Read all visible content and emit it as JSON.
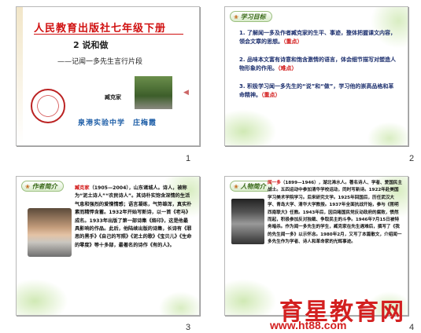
{
  "slides": [
    {
      "number": "1",
      "title": "人民教育出版社七年级下册",
      "lesson": "2 说和做",
      "subtitle": "——记闻一多先生言行片段",
      "author": "臧克家",
      "school": "泉港实验中学　庄梅霞"
    },
    {
      "number": "2",
      "tag": "学习目标",
      "goals": [
        {
          "text": "1. 了解闻一多及作者臧克家的生平、事迹，整体把握课文内容，领会文章的思想。",
          "mark": "（重点）"
        },
        {
          "text": "2. 品味本文富有诗意和饱含激情的语言，体会细节描写对塑造人物形象的作用。",
          "mark": "（难点）"
        },
        {
          "text": "3. 积极学习闻一多先生的“说”和“做”，学习他的崇高品格和革命精神。",
          "mark": "（重点）"
        }
      ]
    },
    {
      "number": "3",
      "tag": "作者简介",
      "name": "臧克家",
      "text": "（1905—2004），山东诸城人。诗人，被称为“泥土诗人”“农民诗人”。其诗朴实饱含深情的生活气息和强烈的爱憎情感；语言凝练，气势雄浑，真实朴素而精悍含蓄。1932年开始写新诗，以一首《老马》成名。1933年出版了第一部诗集《烙印》，这是他最具影响的作品。此后，他陆续出版的诗集，长诗有《罪恶的黑手》《自己的写照》《泥土的歌》《宝贝儿》《生命的零度》等十多部，最著名的诗作《有的人》。"
    },
    {
      "number": "4",
      "tag": "人物简介",
      "name": "闻一多",
      "text": "（1899—1946），湖北浠水人。著名诗人、学者、爱国民主战士。五四运动中参加清华学校运动，同时写新诗。1922年赴美国学习美术学院学习。后来研究文学。1925年回国后，历任武汉大学、青岛大学、清华大学教授。1937年全面抗战开始，参与《昆明西南联大》任教。1943年后，因目睹国民党反动政府的腐败，愤然而起，积极参加反对独裁、争取民主的斗争。1946年7月15日被特务暗杀。作为闻一多先生的学生，臧克家在先生遇难后，撰写了《我的先生闻一多》以示怀念。1980年2月，又写了本篇散文，介绍闻一多先生作为学者、诗人和革命家的光辉事迹。"
    }
  ],
  "watermark": {
    "brand": "育星教育网",
    "url": "www.ht88.com"
  }
}
